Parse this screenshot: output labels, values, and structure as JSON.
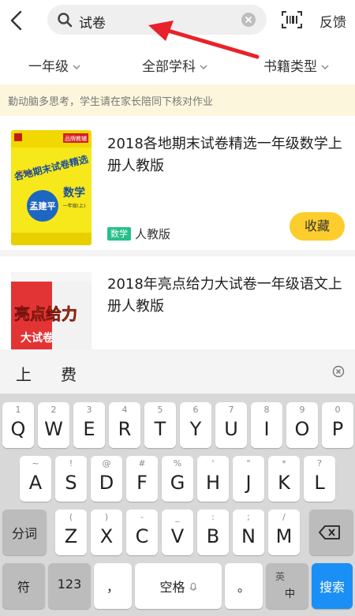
{
  "search": {
    "query": "试卷"
  },
  "header": {
    "feedback": "反馈"
  },
  "filters": {
    "grade": "一年级",
    "subject": "全部学科",
    "book_type": "书籍类型"
  },
  "notice": "勤动脑多思考，学生请在家长陪同下核对作业",
  "books": [
    {
      "title": "2018各地期末试卷精选一年级数学上册人教版",
      "tag": "数学",
      "publisher": "人教版",
      "action": "收藏",
      "cover": {
        "badge": "品牌教辅",
        "series": "各地期末试卷精选",
        "subject": "数学",
        "grade": "一年级(上)",
        "brand": "孟建平",
        "year": "2018"
      }
    },
    {
      "title": "2018年亮点给力大试卷一年级语文上册人教版",
      "cover": {
        "series": "亮点给力",
        "sub": "大试卷"
      }
    }
  ],
  "keyboard": {
    "candidates": [
      "上",
      "费"
    ],
    "row1": [
      {
        "main": "Q",
        "sub": "1"
      },
      {
        "main": "W",
        "sub": "2"
      },
      {
        "main": "E",
        "sub": "3"
      },
      {
        "main": "R",
        "sub": "4"
      },
      {
        "main": "T",
        "sub": "5"
      },
      {
        "main": "Y",
        "sub": "6"
      },
      {
        "main": "U",
        "sub": "7"
      },
      {
        "main": "I",
        "sub": "8"
      },
      {
        "main": "O",
        "sub": "9"
      },
      {
        "main": "P",
        "sub": "0"
      }
    ],
    "row2": [
      {
        "main": "A",
        "sub": "~"
      },
      {
        "main": "S",
        "sub": "!"
      },
      {
        "main": "D",
        "sub": "@"
      },
      {
        "main": "F",
        "sub": "#"
      },
      {
        "main": "G",
        "sub": "%"
      },
      {
        "main": "H",
        "sub": "'"
      },
      {
        "main": "J",
        "sub": "\""
      },
      {
        "main": "K",
        "sub": "*"
      },
      {
        "main": "L",
        "sub": "?"
      }
    ],
    "row3": [
      {
        "main": "Z",
        "sub": "("
      },
      {
        "main": "X",
        "sub": ")"
      },
      {
        "main": "C",
        "sub": "-"
      },
      {
        "main": "V",
        "sub": "_"
      },
      {
        "main": "B",
        "sub": ":"
      },
      {
        "main": "N",
        "sub": ";"
      },
      {
        "main": "M",
        "sub": "/"
      }
    ],
    "segment": "分词",
    "symbols": "符",
    "numbers": "123",
    "comma": "，",
    "space": "空格",
    "period": "。",
    "lang_top": "英",
    "lang_bottom": "中",
    "search": "搜索"
  },
  "colors": {
    "accent_yellow": "#fccd2d",
    "tag_green": "#25c08a",
    "ime_blue": "#1a8ff5",
    "notice_bg": "#fcf7dc",
    "annotation_red": "#e8222a"
  }
}
